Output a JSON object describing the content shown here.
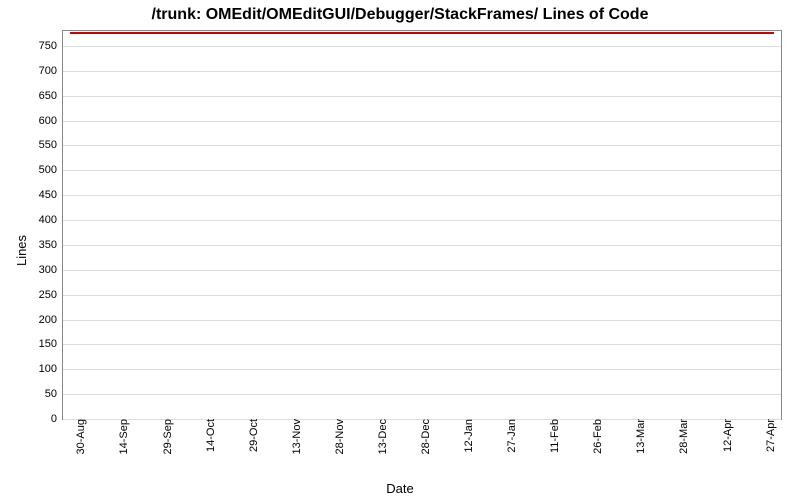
{
  "chart_data": {
    "type": "line",
    "title": "/trunk: OMEdit/OMEditGUI/Debugger/StackFrames/ Lines of Code",
    "xlabel": "Date",
    "ylabel": "Lines",
    "ylim": [
      0,
      780
    ],
    "y_ticks": [
      0,
      50,
      100,
      150,
      200,
      250,
      300,
      350,
      400,
      450,
      500,
      550,
      600,
      650,
      700,
      750
    ],
    "x_ticks": [
      "30-Aug",
      "14-Sep",
      "29-Sep",
      "14-Oct",
      "29-Oct",
      "13-Nov",
      "28-Nov",
      "13-Dec",
      "28-Dec",
      "12-Jan",
      "27-Jan",
      "11-Feb",
      "26-Feb",
      "13-Mar",
      "28-Mar",
      "12-Apr",
      "27-Apr"
    ],
    "series": [
      {
        "name": "Lines of Code",
        "color": "#cc0000",
        "x": [
          "30-Aug",
          "14-Sep",
          "29-Sep",
          "14-Oct",
          "29-Oct",
          "13-Nov",
          "28-Nov",
          "13-Dec",
          "28-Dec",
          "12-Jan",
          "27-Jan",
          "11-Feb",
          "26-Feb",
          "13-Mar",
          "28-Mar",
          "12-Apr",
          "27-Apr"
        ],
        "values": [
          778,
          778,
          778,
          778,
          778,
          778,
          778,
          778,
          778,
          778,
          778,
          778,
          778,
          778,
          778,
          778,
          778
        ]
      }
    ]
  }
}
